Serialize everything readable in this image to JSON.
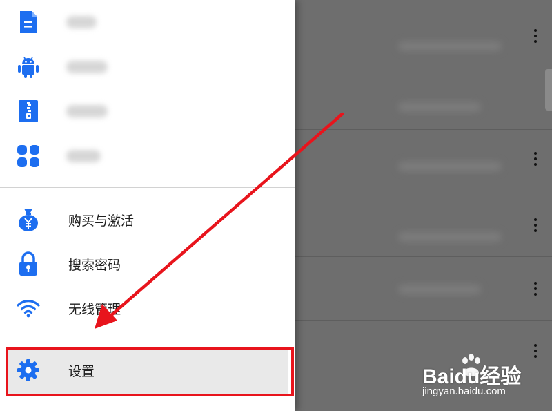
{
  "drawer": {
    "blurred_items": [
      {
        "icon": "document-icon"
      },
      {
        "icon": "android-icon"
      },
      {
        "icon": "zip-archive-icon"
      },
      {
        "icon": "apps-grid-icon"
      }
    ],
    "menu_items": [
      {
        "icon": "money-bag-icon",
        "label": "购买与激活"
      },
      {
        "icon": "lock-icon",
        "label": "搜索密码"
      },
      {
        "icon": "wifi-icon",
        "label": "无线管理"
      }
    ],
    "settings": {
      "icon": "gear-icon",
      "label": "设置"
    }
  },
  "watermark": {
    "brand": "Baidu经验",
    "url": "jingyan.baidu.com"
  },
  "colors": {
    "accent_blue": "#1d6ef0",
    "highlight_red": "#e8141c",
    "overlay_gray": "#6e6e6e"
  }
}
